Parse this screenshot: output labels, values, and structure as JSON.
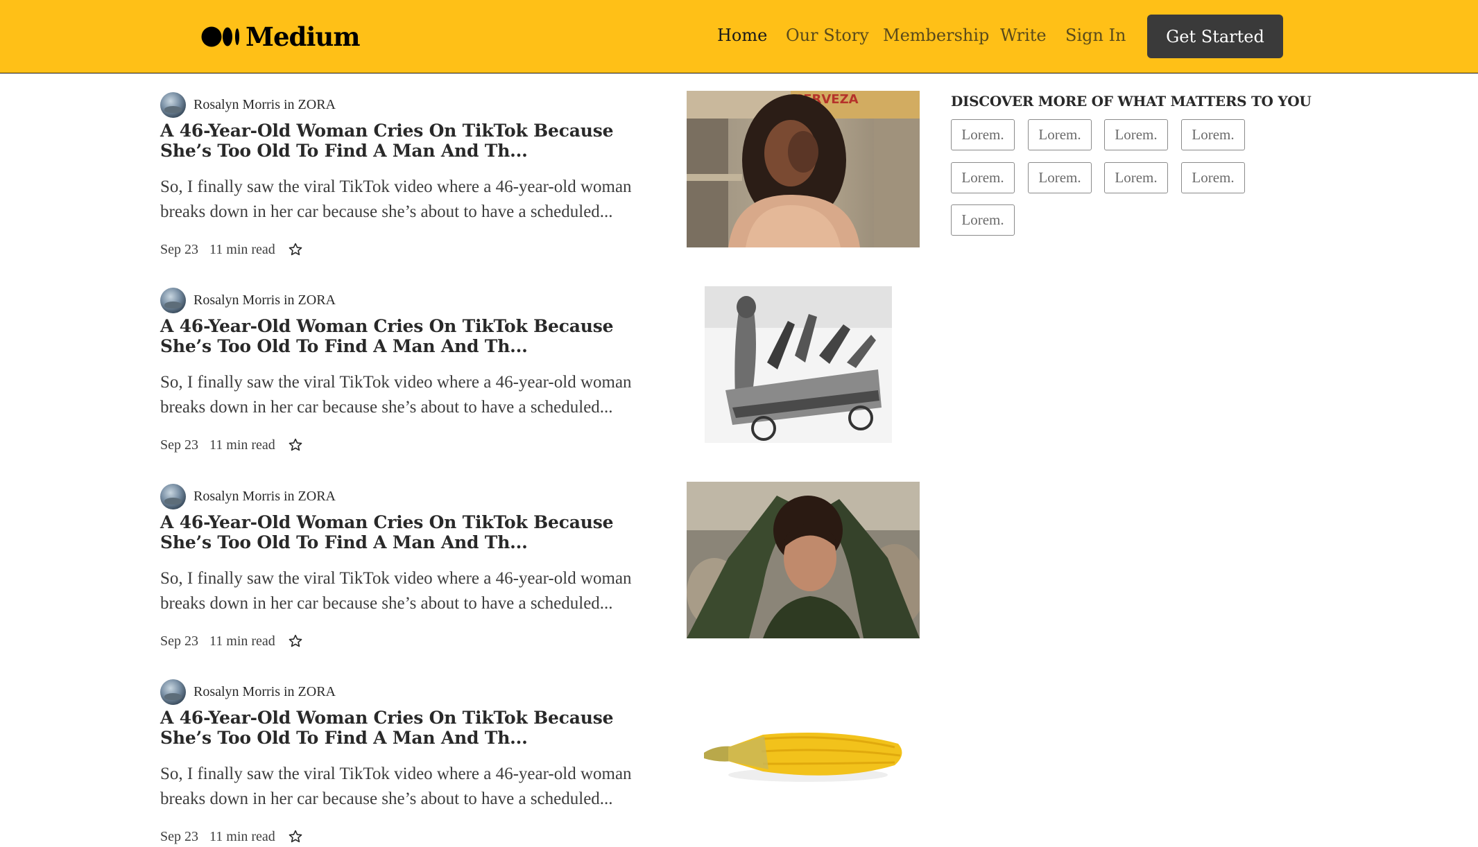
{
  "header": {
    "logo_text": "Medium",
    "nav": [
      {
        "label": "Home",
        "active": true
      },
      {
        "label": "Our Story",
        "active": false
      },
      {
        "label": "Membership",
        "active": false
      },
      {
        "label": "Write",
        "active": false
      },
      {
        "label": "Sign In",
        "active": false
      }
    ],
    "cta_label": "Get Started",
    "background_color": "#FFC017"
  },
  "articles": [
    {
      "author": "Rosalyn Morris in ZORA",
      "title": "A 46-Year-Old Woman Cries On TikTok Because She’s Too Old To Find A Man And Th...",
      "excerpt": "So, I finally saw the viral TikTok video where a 46-year-old woman breaks down in her car because she’s about to have a scheduled...",
      "date": "Sep 23",
      "read_time": "11 min read",
      "thumbnail": "woman-crying-photo"
    },
    {
      "author": "Rosalyn Morris in ZORA",
      "title": "A 46-Year-Old Woman Cries On TikTok Because She’s Too Old To Find A Man And Th...",
      "excerpt": "So, I finally saw the viral TikTok video where a 46-year-old woman breaks down in her car because she’s about to have a scheduled...",
      "date": "Sep 23",
      "read_time": "11 min read",
      "thumbnail": "vintage-engraving-cart"
    },
    {
      "author": "Rosalyn Morris in ZORA",
      "title": "A 46-Year-Old Woman Cries On TikTok Because She’s Too Old To Find A Man And Th...",
      "excerpt": "So, I finally saw the viral TikTok video where a 46-year-old woman breaks down in her car because she’s about to have a scheduled...",
      "date": "Sep 23",
      "read_time": "11 min read",
      "thumbnail": "woman-tying-hair-photo"
    },
    {
      "author": "Rosalyn Morris in ZORA",
      "title": "A 46-Year-Old Woman Cries On TikTok Because She’s Too Old To Find A Man And Th...",
      "excerpt": "So, I finally saw the viral TikTok video where a 46-year-old woman breaks down in her car because she’s about to have a scheduled...",
      "date": "Sep 23",
      "read_time": "11 min read",
      "thumbnail": "corn-cob-photo"
    }
  ],
  "sidebar": {
    "title": "DISCOVER MORE OF WHAT MATTERS TO YOU",
    "tags": [
      "Lorem.",
      "Lorem.",
      "Lorem.",
      "Lorem.",
      "Lorem.",
      "Lorem.",
      "Lorem.",
      "Lorem.",
      "Lorem."
    ]
  }
}
